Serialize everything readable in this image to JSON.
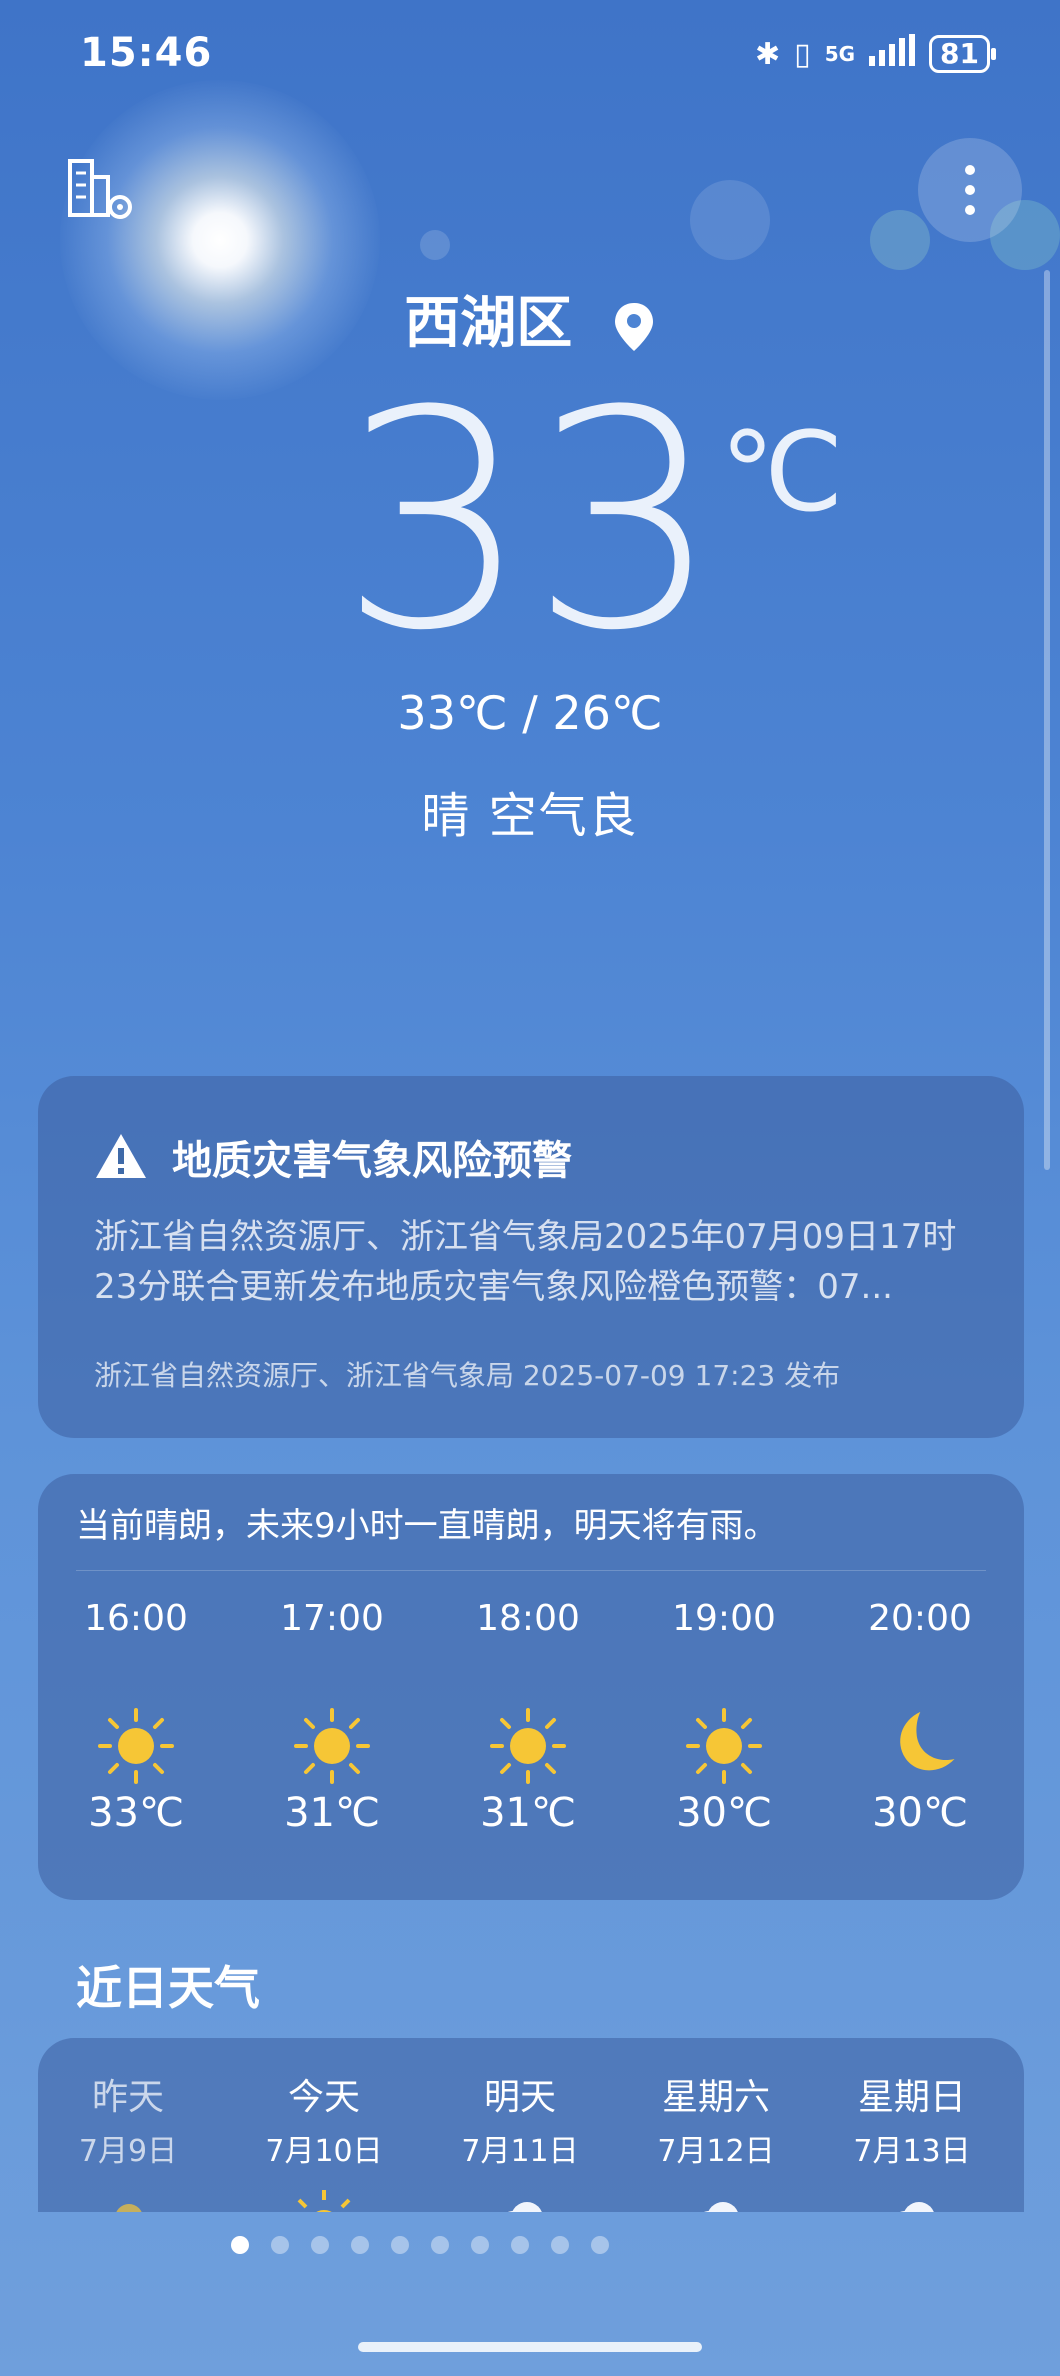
{
  "status_bar": {
    "time": "15:46",
    "signal": "5G",
    "battery": "81"
  },
  "location": {
    "name": "西湖区"
  },
  "current": {
    "temp": "33",
    "unit": "℃",
    "hilo": "33℃ / 26℃",
    "condition": "晴  空气良"
  },
  "warning": {
    "title": "地质灾害气象风险预警",
    "body": "浙江省自然资源厅、浙江省气象局2025年07月09日17时23分联合更新发布地质灾害气象风险橙色预警：07...",
    "source": "浙江省自然资源厅、浙江省气象局 2025-07-09 17:23 发布"
  },
  "hourly": {
    "summary": "当前晴朗，未来9小时一直晴朗，明天将有雨。",
    "items": [
      {
        "time": "16:00",
        "icon": "sun-icon",
        "temp": "33℃"
      },
      {
        "time": "17:00",
        "icon": "sun-icon",
        "temp": "31℃"
      },
      {
        "time": "18:00",
        "icon": "sun-icon",
        "temp": "31℃"
      },
      {
        "time": "19:00",
        "icon": "sun-icon",
        "temp": "30℃"
      },
      {
        "time": "20:00",
        "icon": "moon-icon",
        "temp": "30℃"
      }
    ]
  },
  "daily": {
    "title": "近日天气",
    "items": [
      {
        "name": "昨天",
        "date": "7月9日",
        "icon": "sun-cloud-icon"
      },
      {
        "name": "今天",
        "date": "7月10日",
        "icon": "sun-icon"
      },
      {
        "name": "明天",
        "date": "7月11日",
        "icon": "cloud-icon"
      },
      {
        "name": "星期六",
        "date": "7月12日",
        "icon": "cloud-icon"
      },
      {
        "name": "星期日",
        "date": "7月13日",
        "icon": "cloud-icon"
      }
    ]
  },
  "pager": {
    "count": 10,
    "active": 0
  },
  "colors": {
    "sun": "#f6c636",
    "sun_rays": "#f6c636",
    "moon": "#f6c636"
  }
}
